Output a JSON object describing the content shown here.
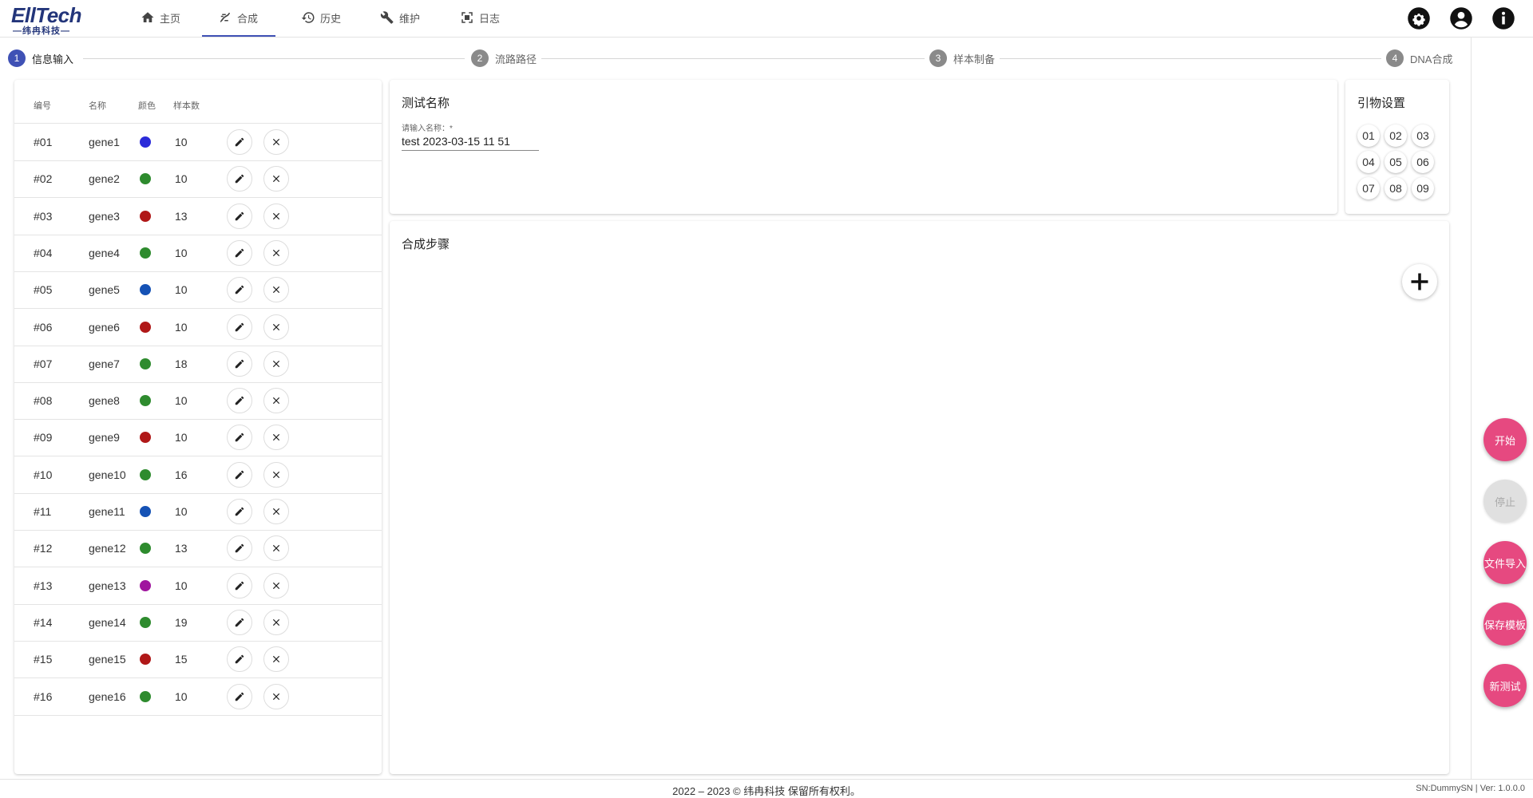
{
  "logo": {
    "main": "EllTech",
    "sub": "—纬冉科技—"
  },
  "nav": [
    {
      "label": "主页",
      "icon": "home-icon"
    },
    {
      "label": "合成",
      "icon": "dna-icon"
    },
    {
      "label": "历史",
      "icon": "history-icon"
    },
    {
      "label": "维护",
      "icon": "tools-icon"
    },
    {
      "label": "日志",
      "icon": "log-icon"
    }
  ],
  "stepper": [
    {
      "num": "1",
      "label": "信息输入"
    },
    {
      "num": "2",
      "label": "流路路径"
    },
    {
      "num": "3",
      "label": "样本制备"
    },
    {
      "num": "4",
      "label": "DNA合成"
    }
  ],
  "gene_table": {
    "headers": [
      "编号",
      "名称",
      "颜色",
      "样本数"
    ],
    "rows": [
      {
        "id": "#01",
        "name": "gene1",
        "color": "#2b2bd9",
        "count": "10"
      },
      {
        "id": "#02",
        "name": "gene2",
        "color": "#2e8b2e",
        "count": "10"
      },
      {
        "id": "#03",
        "name": "gene3",
        "color": "#b01818",
        "count": "13"
      },
      {
        "id": "#04",
        "name": "gene4",
        "color": "#2e8b2e",
        "count": "10"
      },
      {
        "id": "#05",
        "name": "gene5",
        "color": "#1552b5",
        "count": "10"
      },
      {
        "id": "#06",
        "name": "gene6",
        "color": "#b01818",
        "count": "10"
      },
      {
        "id": "#07",
        "name": "gene7",
        "color": "#2e8b2e",
        "count": "18"
      },
      {
        "id": "#08",
        "name": "gene8",
        "color": "#2e8b2e",
        "count": "10"
      },
      {
        "id": "#09",
        "name": "gene9",
        "color": "#b01818",
        "count": "10"
      },
      {
        "id": "#10",
        "name": "gene10",
        "color": "#2e8b2e",
        "count": "16"
      },
      {
        "id": "#11",
        "name": "gene11",
        "color": "#1552b5",
        "count": "10"
      },
      {
        "id": "#12",
        "name": "gene12",
        "color": "#2e8b2e",
        "count": "13"
      },
      {
        "id": "#13",
        "name": "gene13",
        "color": "#a0159e",
        "count": "10"
      },
      {
        "id": "#14",
        "name": "gene14",
        "color": "#2e8b2e",
        "count": "19"
      },
      {
        "id": "#15",
        "name": "gene15",
        "color": "#b01818",
        "count": "15"
      },
      {
        "id": "#16",
        "name": "gene16",
        "color": "#2e8b2e",
        "count": "10"
      }
    ]
  },
  "test_name": {
    "title": "测试名称",
    "label": "请输入名称：*",
    "value": "test 2023-03-15 11 51"
  },
  "primer": {
    "title": "引物设置",
    "items": [
      "01",
      "02",
      "03",
      "04",
      "05",
      "06",
      "07",
      "08",
      "09"
    ]
  },
  "synthesis": {
    "title": "合成步骤"
  },
  "fabs": [
    {
      "label": "开始",
      "disabled": false
    },
    {
      "label": "停止",
      "disabled": true
    },
    {
      "label": "文件导入",
      "disabled": false
    },
    {
      "label": "保存模板",
      "disabled": false
    },
    {
      "label": "新测试",
      "disabled": false
    }
  ],
  "footer": {
    "copyright": "2022 – 2023 © 纬冉科技 保留所有权利。",
    "version": "SN:DummySN | Ver: 1.0.0.0"
  },
  "colors": {
    "accent": "#3f51b5",
    "fab": "#e64980"
  }
}
